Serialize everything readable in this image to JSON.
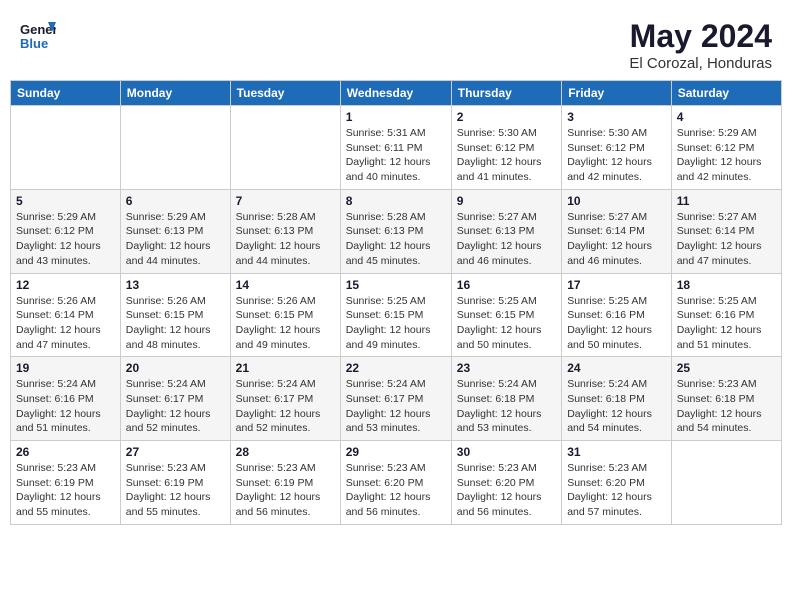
{
  "header": {
    "logo_general": "General",
    "logo_blue": "Blue",
    "month": "May 2024",
    "location": "El Corozal, Honduras"
  },
  "days_of_week": [
    "Sunday",
    "Monday",
    "Tuesday",
    "Wednesday",
    "Thursday",
    "Friday",
    "Saturday"
  ],
  "weeks": [
    [
      {
        "day": "",
        "info": ""
      },
      {
        "day": "",
        "info": ""
      },
      {
        "day": "",
        "info": ""
      },
      {
        "day": "1",
        "info": "Sunrise: 5:31 AM\nSunset: 6:11 PM\nDaylight: 12 hours\nand 40 minutes."
      },
      {
        "day": "2",
        "info": "Sunrise: 5:30 AM\nSunset: 6:12 PM\nDaylight: 12 hours\nand 41 minutes."
      },
      {
        "day": "3",
        "info": "Sunrise: 5:30 AM\nSunset: 6:12 PM\nDaylight: 12 hours\nand 42 minutes."
      },
      {
        "day": "4",
        "info": "Sunrise: 5:29 AM\nSunset: 6:12 PM\nDaylight: 12 hours\nand 42 minutes."
      }
    ],
    [
      {
        "day": "5",
        "info": "Sunrise: 5:29 AM\nSunset: 6:12 PM\nDaylight: 12 hours\nand 43 minutes."
      },
      {
        "day": "6",
        "info": "Sunrise: 5:29 AM\nSunset: 6:13 PM\nDaylight: 12 hours\nand 44 minutes."
      },
      {
        "day": "7",
        "info": "Sunrise: 5:28 AM\nSunset: 6:13 PM\nDaylight: 12 hours\nand 44 minutes."
      },
      {
        "day": "8",
        "info": "Sunrise: 5:28 AM\nSunset: 6:13 PM\nDaylight: 12 hours\nand 45 minutes."
      },
      {
        "day": "9",
        "info": "Sunrise: 5:27 AM\nSunset: 6:13 PM\nDaylight: 12 hours\nand 46 minutes."
      },
      {
        "day": "10",
        "info": "Sunrise: 5:27 AM\nSunset: 6:14 PM\nDaylight: 12 hours\nand 46 minutes."
      },
      {
        "day": "11",
        "info": "Sunrise: 5:27 AM\nSunset: 6:14 PM\nDaylight: 12 hours\nand 47 minutes."
      }
    ],
    [
      {
        "day": "12",
        "info": "Sunrise: 5:26 AM\nSunset: 6:14 PM\nDaylight: 12 hours\nand 47 minutes."
      },
      {
        "day": "13",
        "info": "Sunrise: 5:26 AM\nSunset: 6:15 PM\nDaylight: 12 hours\nand 48 minutes."
      },
      {
        "day": "14",
        "info": "Sunrise: 5:26 AM\nSunset: 6:15 PM\nDaylight: 12 hours\nand 49 minutes."
      },
      {
        "day": "15",
        "info": "Sunrise: 5:25 AM\nSunset: 6:15 PM\nDaylight: 12 hours\nand 49 minutes."
      },
      {
        "day": "16",
        "info": "Sunrise: 5:25 AM\nSunset: 6:15 PM\nDaylight: 12 hours\nand 50 minutes."
      },
      {
        "day": "17",
        "info": "Sunrise: 5:25 AM\nSunset: 6:16 PM\nDaylight: 12 hours\nand 50 minutes."
      },
      {
        "day": "18",
        "info": "Sunrise: 5:25 AM\nSunset: 6:16 PM\nDaylight: 12 hours\nand 51 minutes."
      }
    ],
    [
      {
        "day": "19",
        "info": "Sunrise: 5:24 AM\nSunset: 6:16 PM\nDaylight: 12 hours\nand 51 minutes."
      },
      {
        "day": "20",
        "info": "Sunrise: 5:24 AM\nSunset: 6:17 PM\nDaylight: 12 hours\nand 52 minutes."
      },
      {
        "day": "21",
        "info": "Sunrise: 5:24 AM\nSunset: 6:17 PM\nDaylight: 12 hours\nand 52 minutes."
      },
      {
        "day": "22",
        "info": "Sunrise: 5:24 AM\nSunset: 6:17 PM\nDaylight: 12 hours\nand 53 minutes."
      },
      {
        "day": "23",
        "info": "Sunrise: 5:24 AM\nSunset: 6:18 PM\nDaylight: 12 hours\nand 53 minutes."
      },
      {
        "day": "24",
        "info": "Sunrise: 5:24 AM\nSunset: 6:18 PM\nDaylight: 12 hours\nand 54 minutes."
      },
      {
        "day": "25",
        "info": "Sunrise: 5:23 AM\nSunset: 6:18 PM\nDaylight: 12 hours\nand 54 minutes."
      }
    ],
    [
      {
        "day": "26",
        "info": "Sunrise: 5:23 AM\nSunset: 6:19 PM\nDaylight: 12 hours\nand 55 minutes."
      },
      {
        "day": "27",
        "info": "Sunrise: 5:23 AM\nSunset: 6:19 PM\nDaylight: 12 hours\nand 55 minutes."
      },
      {
        "day": "28",
        "info": "Sunrise: 5:23 AM\nSunset: 6:19 PM\nDaylight: 12 hours\nand 56 minutes."
      },
      {
        "day": "29",
        "info": "Sunrise: 5:23 AM\nSunset: 6:20 PM\nDaylight: 12 hours\nand 56 minutes."
      },
      {
        "day": "30",
        "info": "Sunrise: 5:23 AM\nSunset: 6:20 PM\nDaylight: 12 hours\nand 56 minutes."
      },
      {
        "day": "31",
        "info": "Sunrise: 5:23 AM\nSunset: 6:20 PM\nDaylight: 12 hours\nand 57 minutes."
      },
      {
        "day": "",
        "info": ""
      }
    ]
  ]
}
